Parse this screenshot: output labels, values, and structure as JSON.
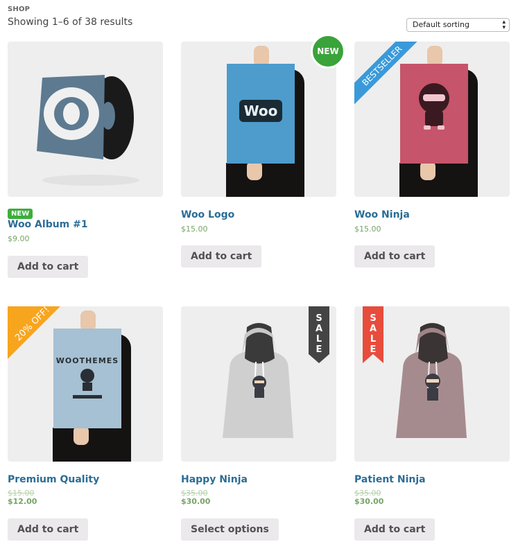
{
  "breadcrumb": "SHOP",
  "result_count": "Showing 1–6 of 38 results",
  "sorting": {
    "selected": "Default sorting"
  },
  "colors": {
    "title": "#2b6d96",
    "price": "#77a464",
    "button_bg": "#ebe9eb",
    "badge_new": "#3aa33a",
    "badge_bestseller": "#3a9ad9",
    "badge_discount": "#f8a51e",
    "badge_sale_dark": "#444444",
    "badge_sale_red": "#e74c3c"
  },
  "products": [
    {
      "name": "Woo Album #1",
      "price": "$9.00",
      "button": "Add to cart",
      "inline_badge": "NEW",
      "image": "album-cover"
    },
    {
      "name": "Woo Logo",
      "price": "$15.00",
      "button": "Add to cart",
      "badge": "NEW",
      "image": "woo-logo-poster",
      "poster_text": "Woo"
    },
    {
      "name": "Woo Ninja",
      "price": "$15.00",
      "button": "Add to cart",
      "badge": "BESTSELLER",
      "image": "ninja-poster"
    },
    {
      "name": "Premium Quality",
      "old_price": "$15.00",
      "price": "$12.00",
      "button": "Add to cart",
      "badge": "20% OFF!",
      "image": "woothemes-poster",
      "poster_text": "WOOTHEMES"
    },
    {
      "name": "Happy Ninja",
      "old_price": "$35.00",
      "price": "$30.00",
      "button": "Select options",
      "badge": [
        "S",
        "A",
        "L",
        "E"
      ],
      "image": "grey-hoodie"
    },
    {
      "name": "Patient Ninja",
      "old_price": "$35.00",
      "price": "$30.00",
      "button": "Add to cart",
      "badge": [
        "S",
        "A",
        "L",
        "E"
      ],
      "image": "pink-hoodie"
    }
  ]
}
